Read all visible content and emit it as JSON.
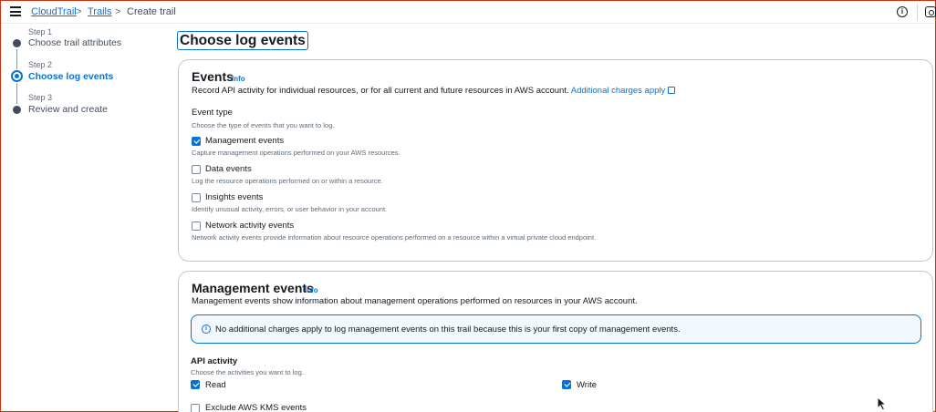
{
  "breadcrumb": {
    "items": [
      "CloudTrail",
      "Trails"
    ],
    "current": "Create trail"
  },
  "header_icons": [
    "menu-icon",
    "info-icon",
    "settings-icon"
  ],
  "steps": [
    {
      "step": "Step 1",
      "title": "Choose trail attributes",
      "active": false
    },
    {
      "step": "Step 2",
      "title": "Choose log events",
      "active": true
    },
    {
      "step": "Step 3",
      "title": "Review and create",
      "active": false
    }
  ],
  "page_title": "Choose log events",
  "events_card": {
    "title": "Events",
    "info": "Info",
    "description": "Record API activity for individual resources, or for all current and future resources in AWS account.",
    "charges_link": "Additional charges apply",
    "event_type_label": "Event type",
    "event_type_desc": "Choose the type of events that you want to log.",
    "options": [
      {
        "label": "Management events",
        "desc": "Capture management operations performed on your AWS resources.",
        "checked": true
      },
      {
        "label": "Data events",
        "desc": "Log the resource operations performed on or within a resource.",
        "checked": false
      },
      {
        "label": "Insights events",
        "desc": "Identify unusual activity, errors, or user behavior in your account.",
        "checked": false
      },
      {
        "label": "Network activity events",
        "desc": "Network activity events provide information about resource operations performed on a resource within a virtual private cloud endpoint.",
        "checked": false
      }
    ]
  },
  "mgmt_card": {
    "title": "Management events",
    "info": "Info",
    "description": "Management events show information about management operations performed on resources in your AWS account.",
    "alert": "No additional charges apply to log management events on this trail because this is your first copy of management events.",
    "api_label": "API activity",
    "api_desc": "Choose the activities you want to log.",
    "read": {
      "label": "Read",
      "checked": true
    },
    "write": {
      "label": "Write",
      "checked": true
    },
    "exclude_kms": {
      "label": "Exclude AWS KMS events",
      "checked": false
    }
  },
  "colors": {
    "accent": "#0972d3",
    "text": "#16191f",
    "border": "#c6c6cd"
  }
}
